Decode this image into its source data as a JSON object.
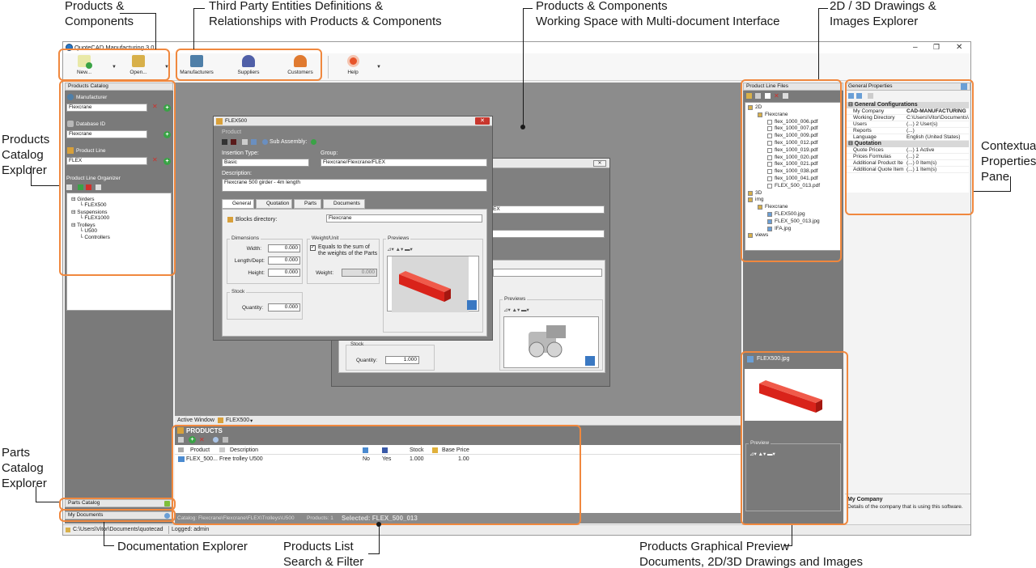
{
  "callouts": {
    "products_components": [
      "Products &",
      "Components"
    ],
    "third_party": [
      "Third Party Entities Definitions &",
      "Relationships with Products & Components"
    ],
    "working_space": [
      "Products & Components",
      "Working Space with Multi-document Interface"
    ],
    "drawings": [
      "2D / 3D Drawings &",
      "Images Explorer"
    ],
    "products_catalog": [
      "Products",
      "Catalog",
      "Explorer"
    ],
    "contextual": [
      "Contextual",
      "Properties",
      "Pane"
    ],
    "parts_catalog": [
      "Parts",
      "Catalog",
      "Explorer"
    ],
    "documentation": "Documentation Explorer",
    "products_list": [
      "Products List",
      "Search & Filter"
    ],
    "graphical_preview": [
      "Products Graphical Preview",
      "Documents, 2D/3D Drawings and Images"
    ]
  },
  "window": {
    "title": "QuoteCAD Manufacturing 3.0",
    "min": "–",
    "restore": "❐",
    "close": "✕"
  },
  "ribbon": {
    "new": "New...",
    "open": "Open...",
    "manufacturers": "Manufacturers",
    "suppliers": "Suppliers",
    "customers": "Customers",
    "help": "Help"
  },
  "products_catalog": {
    "title": "Products Catalog",
    "manufacturer_label": "Manufacturer",
    "manufacturer_value": "Flexcrane",
    "database_label": "Database ID",
    "database_value": "Flexcrane",
    "productline_label": "Product Line",
    "productline_value": "FLEX",
    "organizer_label": "Product Line Organizer",
    "tree": [
      {
        "text": "Girders",
        "level": 0
      },
      {
        "text": "FLEX500",
        "level": 1
      },
      {
        "text": "Suspensions",
        "level": 0
      },
      {
        "text": "FLEX1000",
        "level": 1
      },
      {
        "text": "Trolleys",
        "level": 0
      },
      {
        "text": "U500",
        "level": 1
      },
      {
        "text": "Controllers",
        "level": 1
      }
    ]
  },
  "doc_window": {
    "title": "FLEX500",
    "product_label": "Product",
    "sub_assembly": "Sub Assembly:",
    "insertion_type_label": "Insertion Type:",
    "insertion_type_value": "Basic",
    "group_label": "Group:",
    "group_value": "Flexcrane/Flexcrane/FLEX",
    "description_label": "Description:",
    "description_value": "Flexcrane 500 girder - 4m length",
    "tabs": [
      "General",
      "Quotation",
      "Parts",
      "Documents"
    ],
    "blocks_label": "Blocks directory:",
    "blocks_value": "Flexcrane",
    "dimensions_label": "Dimensions",
    "width_label": "Width:",
    "width_value": "0.000",
    "length_label": "Length/Dept:",
    "length_value": "0.000",
    "height_label": "Height:",
    "height_value": "0.000",
    "weight_group": "Weight/Unit",
    "weight_check": "Equals to the sum of the weights of the Parts",
    "weight_label": "Weight:",
    "weight_value": "0.000",
    "previews_label": "Previews",
    "stock_label": "Stock",
    "quantity_label": "Quantity:",
    "quantity_value": "0.000"
  },
  "back_window": {
    "field1": "EX",
    "previews_label": "Previews",
    "stock_label": "Stock",
    "quantity_label": "Quantity:",
    "quantity_value": "1.000"
  },
  "active_window": {
    "label": "Active Window",
    "value": "FLEX500"
  },
  "products_list": {
    "title": "PRODUCTS",
    "columns": [
      "Product",
      "Description",
      "",
      "",
      "Stock",
      "Base Price"
    ],
    "rows": [
      {
        "product": "FLEX_500...",
        "description": "Free trolley U500",
        "c3": "No",
        "c4": "Yes",
        "stock": "1.000",
        "price": "1.00"
      }
    ],
    "footer_catalog": "Catalog: Flexcrane\\Flexcrane\\FLEX\\Trolleys\\U500",
    "footer_products": "Products: 1",
    "footer_selected": "Selected: FLEX_500_013"
  },
  "product_files": {
    "title": "Product Line Files",
    "tree": [
      {
        "text": "2D",
        "level": 0,
        "kind": "folder"
      },
      {
        "text": "Flexcrane",
        "level": 1,
        "kind": "folder"
      },
      {
        "text": "flex_1000_006.pdf",
        "level": 2,
        "kind": "file"
      },
      {
        "text": "flex_1000_007.pdf",
        "level": 2,
        "kind": "file"
      },
      {
        "text": "flex_1000_009.pdf",
        "level": 2,
        "kind": "file"
      },
      {
        "text": "flex_1000_012.pdf",
        "level": 2,
        "kind": "file"
      },
      {
        "text": "flex_1000_019.pdf",
        "level": 2,
        "kind": "file"
      },
      {
        "text": "flex_1000_020.pdf",
        "level": 2,
        "kind": "file"
      },
      {
        "text": "flex_1000_021.pdf",
        "level": 2,
        "kind": "file"
      },
      {
        "text": "flex_1000_038.pdf",
        "level": 2,
        "kind": "file"
      },
      {
        "text": "flex_1000_041.pdf",
        "level": 2,
        "kind": "file"
      },
      {
        "text": "FLEX_500_013.pdf",
        "level": 2,
        "kind": "file"
      },
      {
        "text": "3D",
        "level": 0,
        "kind": "folder"
      },
      {
        "text": "img",
        "level": 0,
        "kind": "folder"
      },
      {
        "text": "Flexcrane",
        "level": 1,
        "kind": "folder"
      },
      {
        "text": "FLEX500.jpg",
        "level": 2,
        "kind": "image",
        "selected": true
      },
      {
        "text": "FLEX_500_013.jpg",
        "level": 2,
        "kind": "image"
      },
      {
        "text": "IFA.jpg",
        "level": 2,
        "kind": "image"
      },
      {
        "text": "views",
        "level": 0,
        "kind": "folder"
      }
    ],
    "preview_title": "FLEX500.jpg",
    "preview_label": "Preview"
  },
  "general_properties": {
    "title": "General Properties",
    "sections": [
      {
        "name": "General Configurations",
        "rows": [
          [
            "My Company",
            "CAD-MANUFACTURING"
          ],
          [
            "Working Directory",
            "C:\\Users\\Vitor\\Documents\\q"
          ],
          [
            "Users",
            "(...) 2 User(s)"
          ],
          [
            "Reports",
            "(...)"
          ],
          [
            "Language",
            "English (United States)"
          ]
        ]
      },
      {
        "name": "Quotation",
        "rows": [
          [
            "Quote Prices",
            "(...) 1 Active"
          ],
          [
            "Prices Formulas",
            "(...) 2"
          ],
          [
            "Additional Product Ite",
            "(...) 0 Item(s)"
          ],
          [
            "Additional Quote Item",
            "(...) 1 Item(s)"
          ]
        ]
      }
    ],
    "desc_title": "My Company",
    "desc_text": "Details of the company that is using this software."
  },
  "parts_catalog": "Parts Catalog",
  "my_documents": "My Documents",
  "status": {
    "path": "C:\\Users\\Vitor\\Documents\\quotecad",
    "logged": "Logged: admin"
  },
  "colors": {
    "accent": "#f0883e",
    "rail": "#d9231a",
    "green": "#3aa346"
  }
}
